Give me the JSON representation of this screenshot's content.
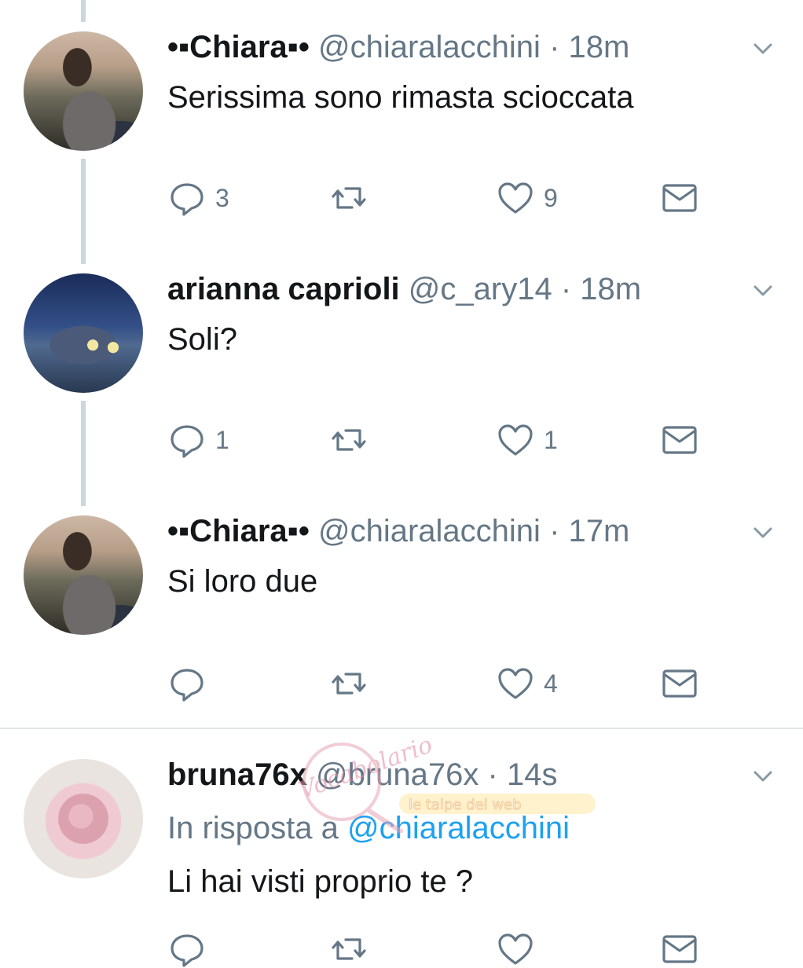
{
  "tweets": [
    {
      "name": "•▪Chiara▪•",
      "handle": "@chiaralacchini",
      "separator": "·",
      "time": "18m",
      "text": "Serissima sono rimasta scioccata",
      "replies": "3",
      "retweets": "",
      "likes": "9"
    },
    {
      "name": "arianna caprioli",
      "handle": "@c_ary14",
      "separator": "·",
      "time": "18m",
      "text": "Soli?",
      "replies": "1",
      "retweets": "",
      "likes": "1"
    },
    {
      "name": "•▪Chiara▪•",
      "handle": "@chiaralacchini",
      "separator": "·",
      "time": "17m",
      "text": "Si loro due",
      "replies": "",
      "retweets": "",
      "likes": "4"
    },
    {
      "name": "bruna76x",
      "handle": "@bruna76x",
      "separator": "·",
      "time": "14s",
      "reply_to_prefix": "In risposta a",
      "reply_to_mention": "@chiaralacchini",
      "text": "Li hai visti proprio te ?"
    }
  ],
  "watermark": {
    "line1": "Vocabolario",
    "line2": "le talpe del web"
  },
  "colors": {
    "text": "#14171a",
    "secondary": "#657786",
    "link": "#1da1f2",
    "thread_line": "#ccd6dd"
  },
  "icons": [
    "reply-icon",
    "retweet-icon",
    "like-icon",
    "message-icon",
    "chevron-down-icon"
  ]
}
